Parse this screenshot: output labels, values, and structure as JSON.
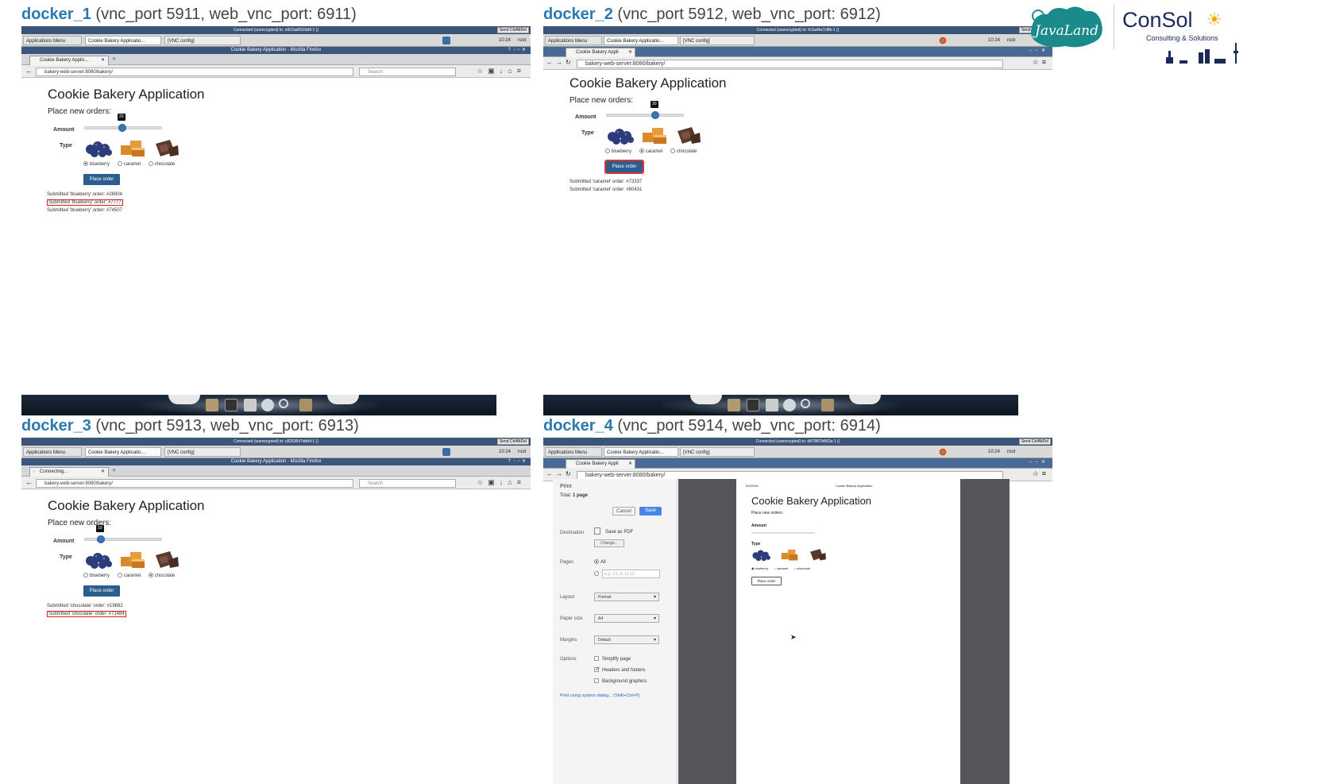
{
  "panels": [
    {
      "name": "docker_1",
      "ports": "(vnc_port 5911, web_vnc_port: 6911)",
      "vnc_status": "Connected (unencrypted) to: e822ad692dd6:1 ()",
      "send_cad": "Send CtrlAltDel",
      "taskbar": {
        "menu": "Applications Menu",
        "win1": "Cookie Bakery Applicatio...",
        "win2": "[VNC config]",
        "clock": "10:24",
        "user": "root"
      },
      "window_title": "Cookie Bakery Application - Mozilla Firefox",
      "tab_label": "Cookie Bakery Applic...",
      "url": "bakery-web-server:8080/bakery/",
      "search_placeholder": "Search",
      "app_title": "Cookie Bakery Application",
      "app_subtitle": "Place new orders:",
      "amount_label": "Amount",
      "amount_value": "20",
      "amount_fraction": 0.48,
      "type_label": "Type",
      "options": [
        "blueberry",
        "caramel",
        "chocolate"
      ],
      "selected": "blueberry",
      "button": "Place order",
      "orders": [
        "Submitted 'blueberry' order: #26904",
        "Submitted 'blueberry' order: #7777",
        "Submitted 'blueberry' order: #74507"
      ],
      "highlighted_order_index": 1
    },
    {
      "name": "docker_2",
      "ports": "(vnc_port 5912, web_vnc_port: 6912)",
      "vnc_status": "Connected (unencrypted) to: fc3ad4a7cf8b:1 ()",
      "send_cad": "Send CtrlAltDel",
      "taskbar": {
        "menu": "Applications Menu",
        "win1": "Cookie Bakery Applicatio...",
        "win2": "[VNC config]",
        "clock": "10:24",
        "user": "root"
      },
      "tab_label": "Cookie Bakery Appli",
      "url": "bakery-web-server:8080/bakery/",
      "app_title": "Cookie Bakery Application",
      "app_subtitle": "Place new orders:",
      "amount_label": "Amount",
      "amount_value": "30",
      "amount_fraction": 0.62,
      "type_label": "Type",
      "options": [
        "blueberry",
        "caramel",
        "chocolate"
      ],
      "selected": "caramel",
      "button": "Place order",
      "orders": [
        "Submitted 'caramel' order: #73337",
        "Submitted 'caramel' order: #80431"
      ]
    },
    {
      "name": "docker_3",
      "ports": "(vnc_port 5913, web_vnc_port: 6913)",
      "vnc_status": "Connected (unencrypted) to: c8253647ddd4:1 ()",
      "send_cad": "Send CtrlAltDel",
      "taskbar": {
        "menu": "Applications Menu",
        "win1": "Cookie Bakery Applicatio...",
        "win2": "[VNC config]",
        "clock": "10:24",
        "user": "root"
      },
      "window_title": "Cookie Bakery Application - Mozilla Firefox",
      "tab_label": "Connecting...",
      "url": "bakery-web-server:8080/bakery/",
      "search_placeholder": "Search",
      "app_title": "Cookie Bakery Application",
      "app_subtitle": "Place new orders:",
      "amount_label": "Amount",
      "amount_value": "10",
      "amount_fraction": 0.2,
      "type_label": "Type",
      "options": [
        "blueberry",
        "caramel",
        "chocolate"
      ],
      "selected": "chocolate",
      "button": "Place order",
      "orders": [
        "Submitted 'chocolate' order: #19682",
        "Submitted 'chocolate' order: #71484"
      ],
      "highlighted_order_index": 1
    },
    {
      "name": "docker_4",
      "ports": "(vnc_port 5914, web_vnc_port: 6914)",
      "vnc_status": "Connected (unencrypted) to: d879f57b852e:1 ()",
      "send_cad": "Send CtrlAltDel",
      "taskbar": {
        "menu": "Applications Menu",
        "win1": "Cookie Bakery Applicatio...",
        "win2": "[VNC config]",
        "clock": "10:24",
        "user": "root"
      },
      "tab_label": "Cookie Bakery Appli",
      "url": "bakery-web-server:8080/bakery/",
      "print": {
        "title": "Print",
        "total_prefix": "Total: ",
        "total_value": "1 page",
        "cancel": "Cancel",
        "save": "Save",
        "destination_label": "Destination",
        "destination_value": "Save as PDF",
        "change": "Change...",
        "pages_label": "Pages",
        "pages_all": "All",
        "pages_placeholder": "e.g. 1-5, 8, 11-13",
        "layout_label": "Layout",
        "layout_value": "Portrait",
        "paper_label": "Paper size",
        "paper_value": "A4",
        "margins_label": "Margins",
        "margins_value": "Default",
        "options_label": "Options",
        "opt1": "Simplify page",
        "opt2": "Headers and footers",
        "opt3": "Background graphics",
        "system_dialog": "Print using system dialog... (Shift+Ctrl+P)",
        "preview_date": "5/9/2016",
        "preview_header": "Cookie Bakery Application",
        "preview_title": "Cookie Bakery Application",
        "preview_subtitle": "Place new orders:",
        "preview_amount": "Amount",
        "preview_type": "Type",
        "preview_button": "Place order",
        "preview_options": [
          "blueberry",
          "caramel",
          "chocolate"
        ]
      }
    }
  ],
  "logos": {
    "javaland": "JavaLand",
    "consol": "ConSol",
    "consol_tagline": "Consulting & Solutions"
  },
  "colors": {
    "accent": "#2a7ab0",
    "button": "#2b5e8e",
    "highlight": "#e02020"
  }
}
